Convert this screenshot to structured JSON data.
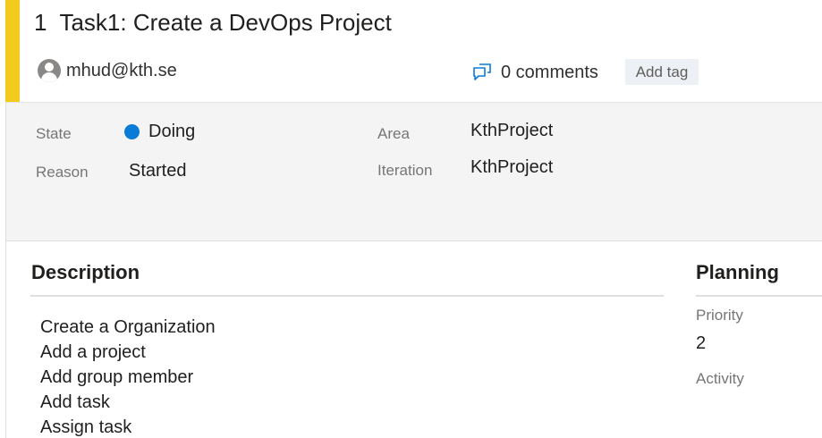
{
  "work_item": {
    "id": "1",
    "title": "Task1: Create a DevOps Project",
    "assigned_to": "mhud@kth.se",
    "comments_label": "0 comments",
    "add_tag_label": "Add tag"
  },
  "fields": {
    "state_label": "State",
    "state_value": "Doing",
    "state_color": "#0a7bd6",
    "reason_label": "Reason",
    "reason_value": "Started",
    "area_label": "Area",
    "area_value": "KthProject",
    "iteration_label": "Iteration",
    "iteration_value": "KthProject"
  },
  "description": {
    "title": "Description",
    "lines": [
      "Create a Organization",
      "Add a project",
      "Add group member",
      "Add task",
      "Assign task"
    ]
  },
  "planning": {
    "title": "Planning",
    "priority_label": "Priority",
    "priority_value": "2",
    "activity_label": "Activity",
    "activity_value": ""
  },
  "colors": {
    "accent": "#f2cb1d",
    "field_background": "#f4f4f4",
    "tag_background": "#edf1f5"
  },
  "icons": {
    "avatar": "person-avatar-icon",
    "comments": "comments-icon",
    "state": "state-dot-icon"
  }
}
